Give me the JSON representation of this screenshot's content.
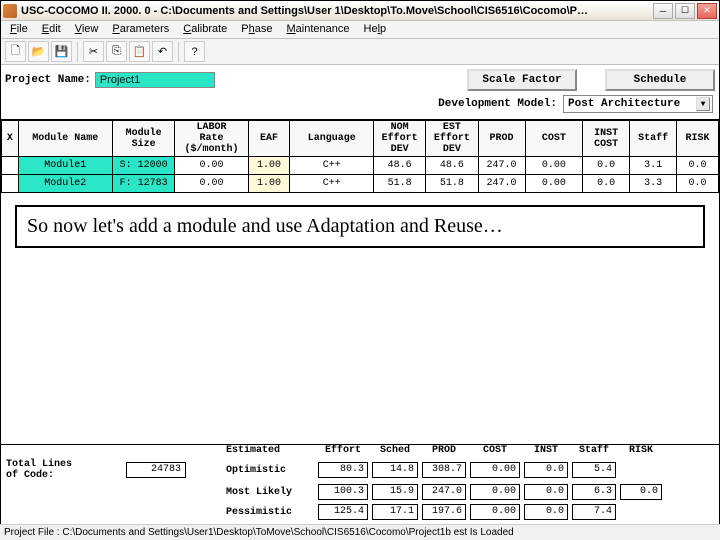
{
  "title": "USC-COCOMO II. 2000. 0 - C:\\Documents and Settings\\User 1\\Desktop\\To.Move\\School\\CIS6516\\Cocomo\\P…",
  "menu": {
    "file": "File",
    "edit": "Edit",
    "view": "View",
    "parameters": "Parameters",
    "calibrate": "Calibrate",
    "phase": "Phase",
    "maintenance": "Maintenance",
    "help": "Help"
  },
  "project": {
    "name_label": "Project Name:",
    "name": "Project1"
  },
  "buttons": {
    "scale_factor": "Scale Factor",
    "schedule": "Schedule"
  },
  "dev": {
    "label": "Development Model:",
    "value": "Post Architecture"
  },
  "headers": {
    "x": "X",
    "mod_name": "Module Name",
    "mod_size": "Module\nSize",
    "labor": "LABOR\nRate\n($/month)",
    "eaf": "EAF",
    "lang": "Language",
    "nom": "NOM\nEffort\nDEV",
    "est": "EST\nEffort\nDEV",
    "prod": "PROD",
    "cost": "COST",
    "inst": "INST\nCOST",
    "staff": "Staff",
    "risk": "RISK"
  },
  "rows": [
    {
      "name": "Module1",
      "size": "S: 12000",
      "labor": "0.00",
      "eaf": "1.00",
      "lang": "C++",
      "nom": "48.6",
      "est": "48.6",
      "prod": "247.0",
      "cost": "0.00",
      "inst": "0.0",
      "staff": "3.1",
      "risk": "0.0"
    },
    {
      "name": "Module2",
      "size": "F: 12783",
      "labor": "0.00",
      "eaf": "1.00",
      "lang": "C++",
      "nom": "51.8",
      "est": "51.8",
      "prod": "247.0",
      "cost": "0.00",
      "inst": "0.0",
      "staff": "3.3",
      "risk": "0.0"
    }
  ],
  "callout": "So now let's add a module and use Adaptation and Reuse…",
  "summary": {
    "headers": {
      "estimated": "Estimated",
      "effort": "Effort",
      "sched": "Sched",
      "prod": "PROD",
      "cost": "COST",
      "inst": "INST",
      "staff": "Staff",
      "risk": "RISK"
    },
    "total_label": "Total Lines\nof Code:",
    "total_loc": "24783",
    "rows": [
      {
        "label": "Optimistic",
        "effort": "80.3",
        "sched": "14.8",
        "prod": "308.7",
        "cost": "0.00",
        "inst": "0.0",
        "staff": "5.4",
        "risk": ""
      },
      {
        "label": "Most Likely",
        "effort": "100.3",
        "sched": "15.9",
        "prod": "247.0",
        "cost": "0.00",
        "inst": "0.0",
        "staff": "6.3",
        "risk": "0.0"
      },
      {
        "label": "Pessimistic",
        "effort": "125.4",
        "sched": "17.1",
        "prod": "197.6",
        "cost": "0.00",
        "inst": "0.0",
        "staff": "7.4",
        "risk": ""
      }
    ]
  },
  "status": "Project File : C:\\Documents and Settings\\User1\\Desktop\\ToMove\\School\\CIS6516\\Cocomo\\Project1b est Is Loaded"
}
